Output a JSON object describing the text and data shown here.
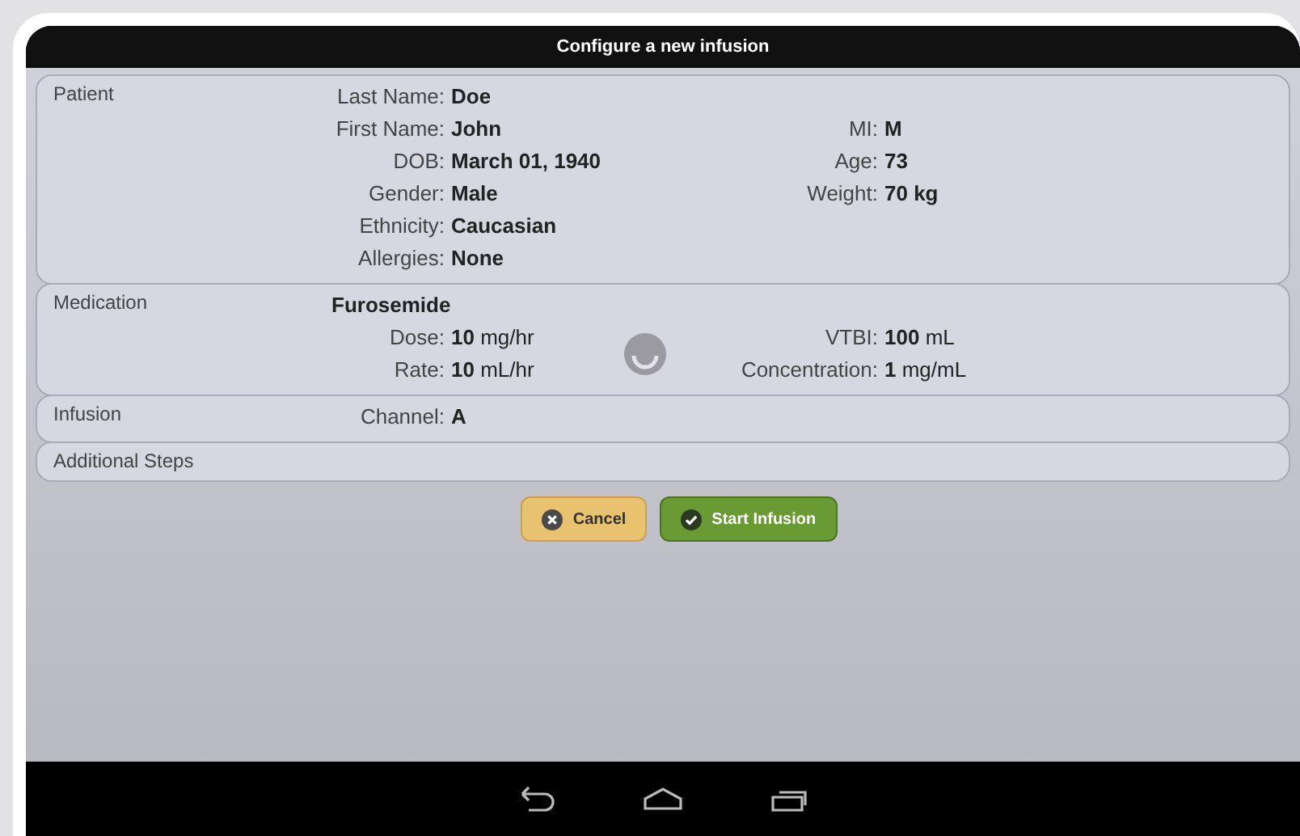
{
  "title": "Configure a new infusion",
  "sections": [
    {
      "title": "Patient",
      "kind": "patient",
      "rows": [
        {
          "left": {
            "label": "Last Name:",
            "value": "Doe"
          }
        },
        {
          "left": {
            "label": "First Name:",
            "value": "John"
          },
          "right": {
            "label": "MI:",
            "value": "M"
          }
        },
        {
          "left": {
            "label": "DOB:",
            "value": "March 01, 1940"
          },
          "right": {
            "label": "Age:",
            "value": "73"
          }
        },
        {
          "left": {
            "label": "Gender:",
            "value": "Male"
          },
          "right": {
            "label": "Weight:",
            "value": "70 kg"
          }
        },
        {
          "left": {
            "label": "Ethnicity:",
            "value": "Caucasian"
          }
        },
        {
          "left": {
            "label": "Allergies:",
            "value": "None"
          }
        }
      ]
    },
    {
      "title": "Medication",
      "kind": "medication",
      "heading": "Furosemide",
      "rows": [
        {
          "left": {
            "label": "Dose:",
            "value": "**10** mg/hr"
          },
          "right": {
            "label": "VTBI:",
            "value": "**100** mL"
          }
        },
        {
          "left": {
            "label": "Rate:",
            "value": "**10** mL/hr"
          },
          "right": {
            "label": "Concentration:",
            "value": "**1** mg/mL"
          }
        }
      ]
    },
    {
      "title": "Infusion",
      "kind": "patient",
      "rows": [
        {
          "left": {
            "label": "Channel:",
            "value": "A"
          }
        }
      ]
    },
    {
      "title": "Additional Steps"
    }
  ],
  "buttons": [
    {
      "label": "Cancel",
      "kind": "cancel"
    },
    {
      "label": "Start Infusion",
      "kind": "confirm"
    }
  ]
}
